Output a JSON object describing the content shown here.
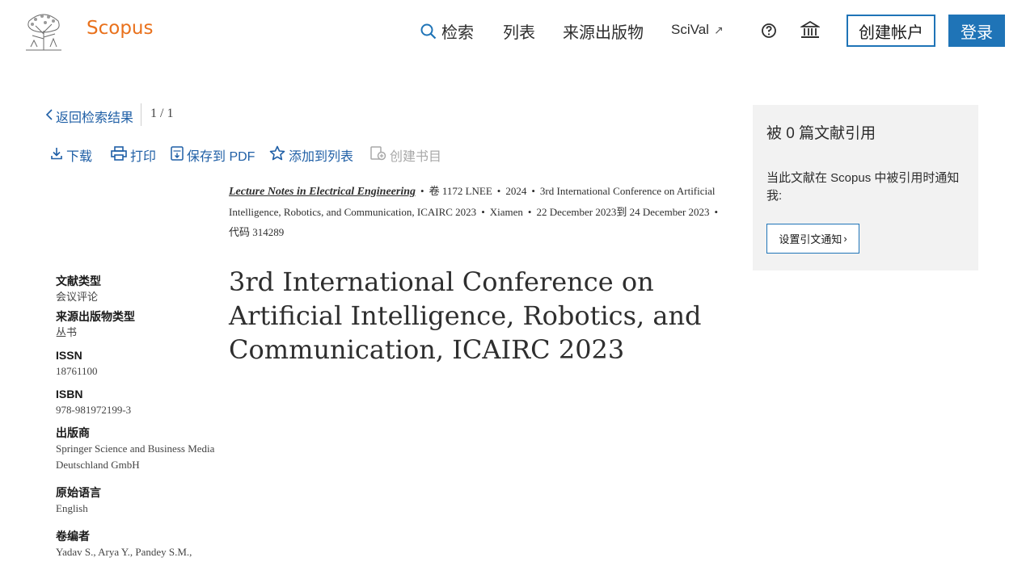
{
  "header": {
    "brand": "Scopus",
    "nav": {
      "search": "检索",
      "lists": "列表",
      "sources": "来源出版物",
      "scival": "SciVal",
      "scival_arrow": "↗"
    },
    "create_account": "创建帐户",
    "sign_in": "登录",
    "icons": [
      "elsevier-logo",
      "search-icon",
      "external-link-icon",
      "help-icon",
      "institution-icon"
    ]
  },
  "navigation": {
    "back": "返回检索结果",
    "pager": "1 / 1"
  },
  "toolbar": {
    "download": "下载",
    "print": "打印",
    "save_pdf": "保存到 PDF",
    "add_to_list": "添加到列表",
    "create_bib": "创建书目"
  },
  "source": {
    "title": "Lecture Notes in Electrical Engineering",
    "volume": "卷 1172 LNEE",
    "year": "2024",
    "conference": "3rd International Conference on Artificial Intelligence, Robotics, and Communication, ICAIRC 2023",
    "location": "Xiamen",
    "dates": "22 December 2023到 24 December 2023",
    "code": "代码 314289",
    "separator": "•"
  },
  "document": {
    "title": "3rd International Conference on Artificial Intelligence, Robotics, and Communication, ICAIRC 2023"
  },
  "metadata": {
    "doc_type_label": "文献类型",
    "doc_type_value": "会议评论",
    "source_type_label": "来源出版物类型",
    "source_type_value": "丛书",
    "issn_label": "ISSN",
    "issn_value": "18761100",
    "isbn_label": "ISBN",
    "isbn_value": "978-981972199-3",
    "publisher_label": "出版商",
    "publisher_value": "Springer Science and Business Media Deutschland GmbH",
    "language_label": "原始语言",
    "language_value": "English",
    "editors_label": "卷编者",
    "editors_value": "Yadav S., Arya Y., Pandey S.M.,"
  },
  "citations": {
    "title": "被 0 篇文献引用",
    "alert_text": "当此文献在 Scopus 中被引用时通知我:",
    "alert_button": "设置引文通知",
    "alert_chevron": "›"
  },
  "colors": {
    "brand": "#e9711c",
    "link": "#1f5fa6",
    "primary": "#1f74b7",
    "panel": "#f2f2f2"
  }
}
